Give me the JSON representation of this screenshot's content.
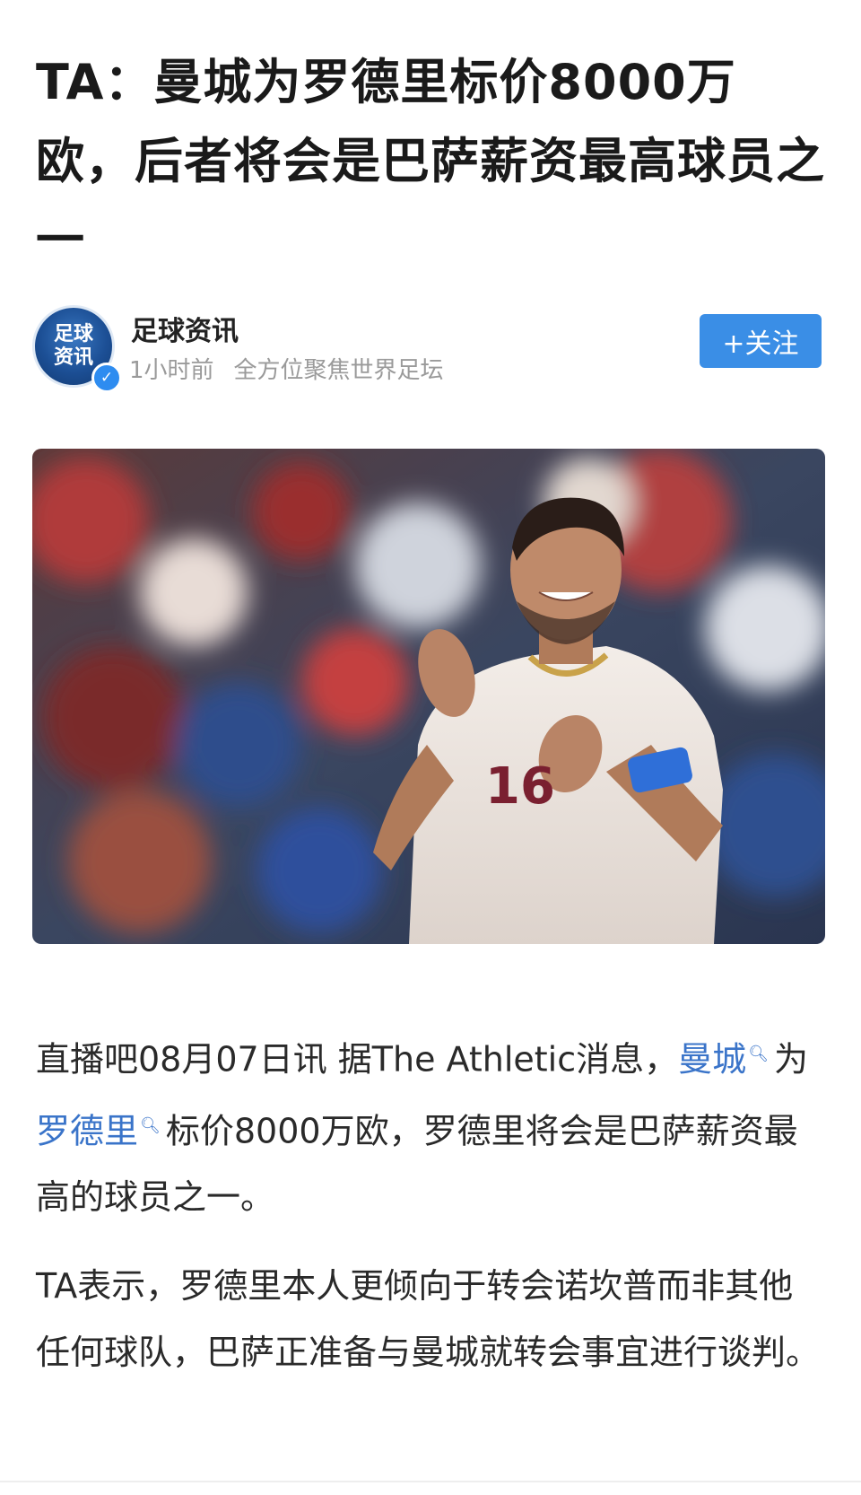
{
  "article": {
    "title": "TA：曼城为罗德里标价8000万欧，后者将会是巴萨薪资最高球员之一"
  },
  "author": {
    "name": "足球资讯",
    "avatar_text_line1": "足球",
    "avatar_text_line2": "资讯",
    "time": "1小时前",
    "slogan": "全方位聚焦世界足坛",
    "follow_label": "+关注"
  },
  "photo": {
    "jersey_number": "16"
  },
  "body": {
    "p1_part1": "直播吧08月07日讯  据The Athletic消息，",
    "p1_link1": "曼城",
    "p1_part2": "为",
    "p1_link2": "罗德里",
    "p1_part3": "标价8000万欧，罗德里将会是巴萨薪资最高的球员之一。",
    "p2": "TA表示，罗德里本人更倾向于转会诺坎普而非其他任何球队，巴萨正准备与曼城就转会事宜进行谈判。"
  },
  "colors": {
    "link": "#3a74c9",
    "follow_button": "#3a8ee6",
    "meta_text": "#9a9a9a"
  },
  "icons": [
    "verified-badge-icon",
    "search-icon",
    "plus-icon"
  ]
}
